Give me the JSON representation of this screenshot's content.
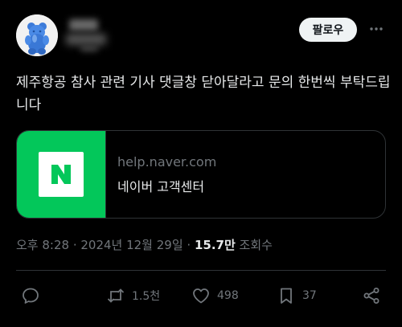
{
  "author": {
    "avatar_icon": "gummy-bear-avatar",
    "name_hidden": true
  },
  "header": {
    "follow_label": "팔로우",
    "more_icon": "more-horizontal-icon"
  },
  "tweet": {
    "text": "제주항공 참사 관련 기사 댓글창 닫아달라고 문의 한번씩 부탁드립니다"
  },
  "card": {
    "thumb_color": "#03c75a",
    "logo_letter": "N",
    "domain": "help.naver.com",
    "title": "네이버 고객센터"
  },
  "meta": {
    "timestamp": "오후 8:28 · 2024년 12월 29일 · ",
    "views_count": "15.7만",
    "views_label": " 조회수"
  },
  "actions": {
    "reply_icon": "reply-icon",
    "retweet_icon": "retweet-icon",
    "retweet_count": "1.5천",
    "like_icon": "heart-icon",
    "like_count": "498",
    "bookmark_icon": "bookmark-icon",
    "bookmark_count": "37",
    "share_icon": "share-icon"
  }
}
